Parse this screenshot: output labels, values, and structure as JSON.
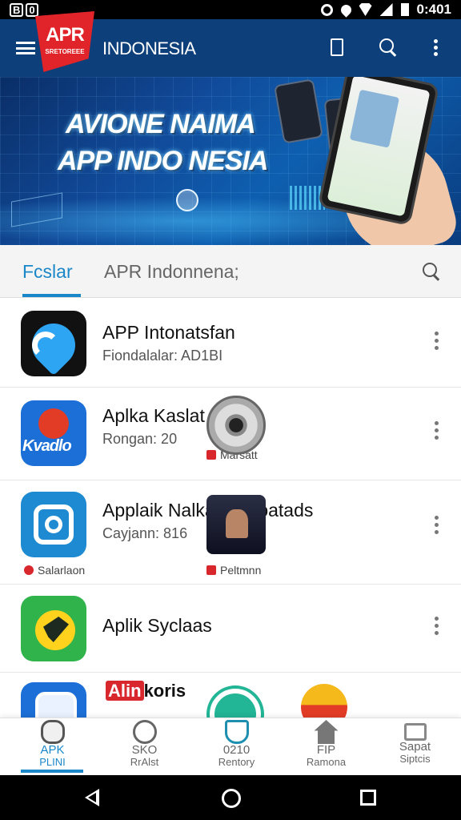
{
  "status_bar": {
    "left_icons": [
      "B",
      "0"
    ],
    "time": "0:401",
    "icons": [
      "alarm-icon",
      "drop-icon",
      "wifi-icon",
      "signal-icon",
      "battery-icon"
    ]
  },
  "app_bar": {
    "logo_text": "APR",
    "logo_sub": "SRETOREEE",
    "title": "INDONESIA",
    "icons": [
      "hamburger-icon",
      "document-icon",
      "search-icon",
      "more-icon"
    ]
  },
  "banner": {
    "line1": "AVIONE NAIMA",
    "line2": "APP INDO NESIA"
  },
  "tabs": {
    "active": "Fcslar",
    "other": "APR Indonnena;"
  },
  "apps": [
    {
      "name": "APP  Intonatsfan",
      "sub": "Fiondalalar: AD1BI"
    },
    {
      "name": "Aplka Kaslat",
      "sub": "Rongan: 20",
      "badge": "Marsatt"
    },
    {
      "name": "Applaik NalkalN 10oatads",
      "sub": "Cayjann: 816",
      "badge_left": "Salarlaon",
      "badge": "Peltmnn"
    },
    {
      "name": "Aplik Syclaas"
    }
  ],
  "partial_row": {
    "text_red": "Alin",
    "text": "koris"
  },
  "bottom_nav": [
    {
      "l1": "APK",
      "l2": "PLINI",
      "icon": "apk-icon",
      "active": true
    },
    {
      "l1": "SKO",
      "l2": "RrAlst",
      "icon": "gear-icon"
    },
    {
      "l1": "0210",
      "l2": "Rentory",
      "icon": "shield-icon"
    },
    {
      "l1": "FIP",
      "l2": "Ramona",
      "icon": "home-icon"
    },
    {
      "l1": "Sapat",
      "l2": "Siptcis",
      "icon": "box-icon"
    }
  ],
  "colors": {
    "app_bar": "#0d3f7a",
    "accent": "#1a87c8",
    "logo_red": "#e0242a"
  }
}
